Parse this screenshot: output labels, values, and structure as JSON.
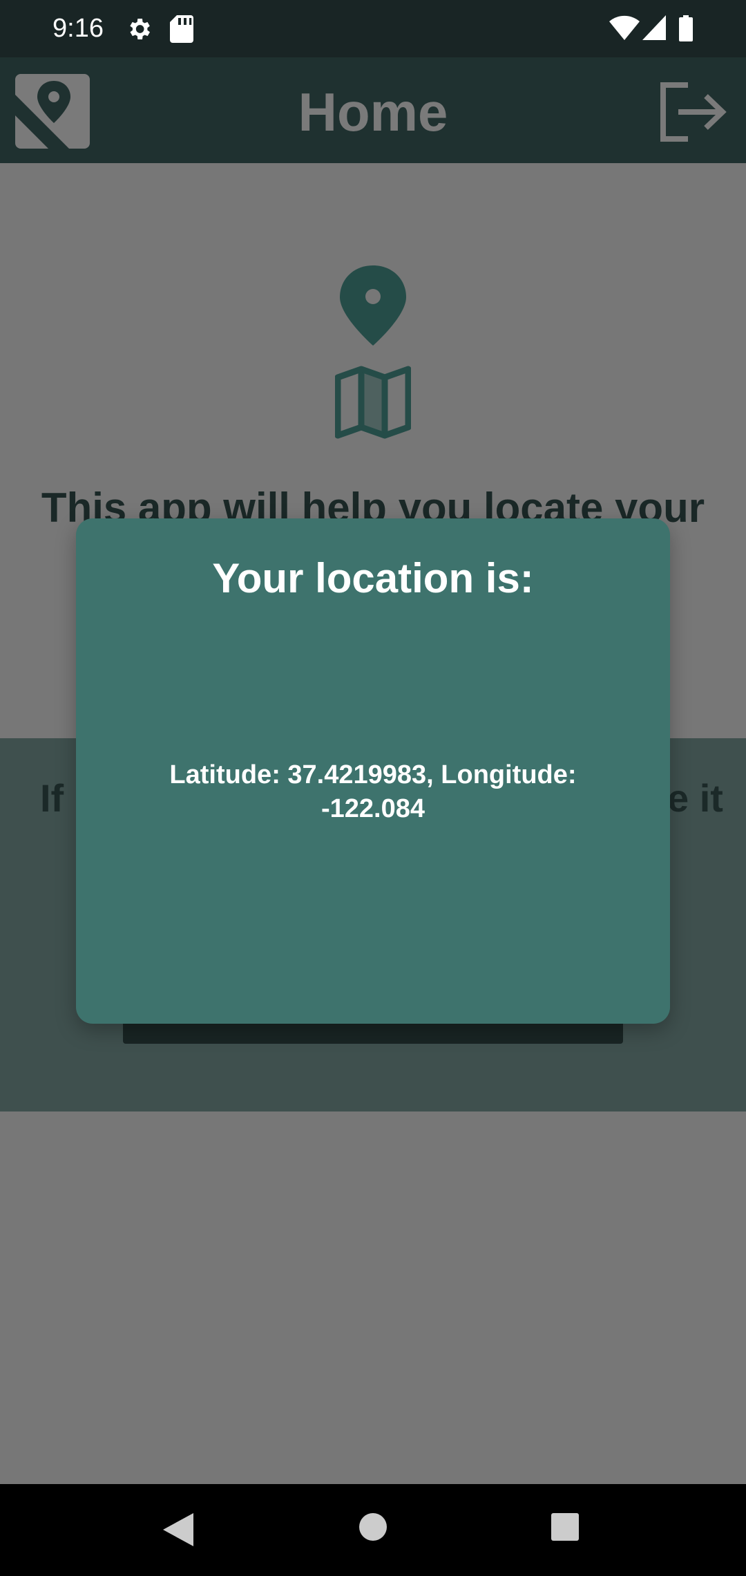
{
  "status_bar": {
    "time": "9:16",
    "icons": [
      "settings-icon",
      "sd-card-icon",
      "wifi-icon",
      "signal-icon",
      "battery-icon"
    ]
  },
  "app_bar": {
    "title": "Home",
    "icons": [
      "location-logo-icon",
      "logout-icon"
    ]
  },
  "background": {
    "hero_icons": [
      "map-pin-icon",
      "map-icon"
    ],
    "hero_text": "This app will help you locate your",
    "band_text_left": "If",
    "band_text_right": "e it"
  },
  "dialog": {
    "title": "Your location is:",
    "body_line1": "Latitude: 37.4219983, Longitude:",
    "body_line2": "-122.084"
  },
  "nav_bar": {
    "icons": [
      "back-icon",
      "home-icon",
      "recents-icon"
    ]
  },
  "colors": {
    "status_bar": "#192525",
    "app_bar": "#1f3130",
    "scrim": "#777777",
    "accent": "#3e736d",
    "band": "#3f504e"
  }
}
